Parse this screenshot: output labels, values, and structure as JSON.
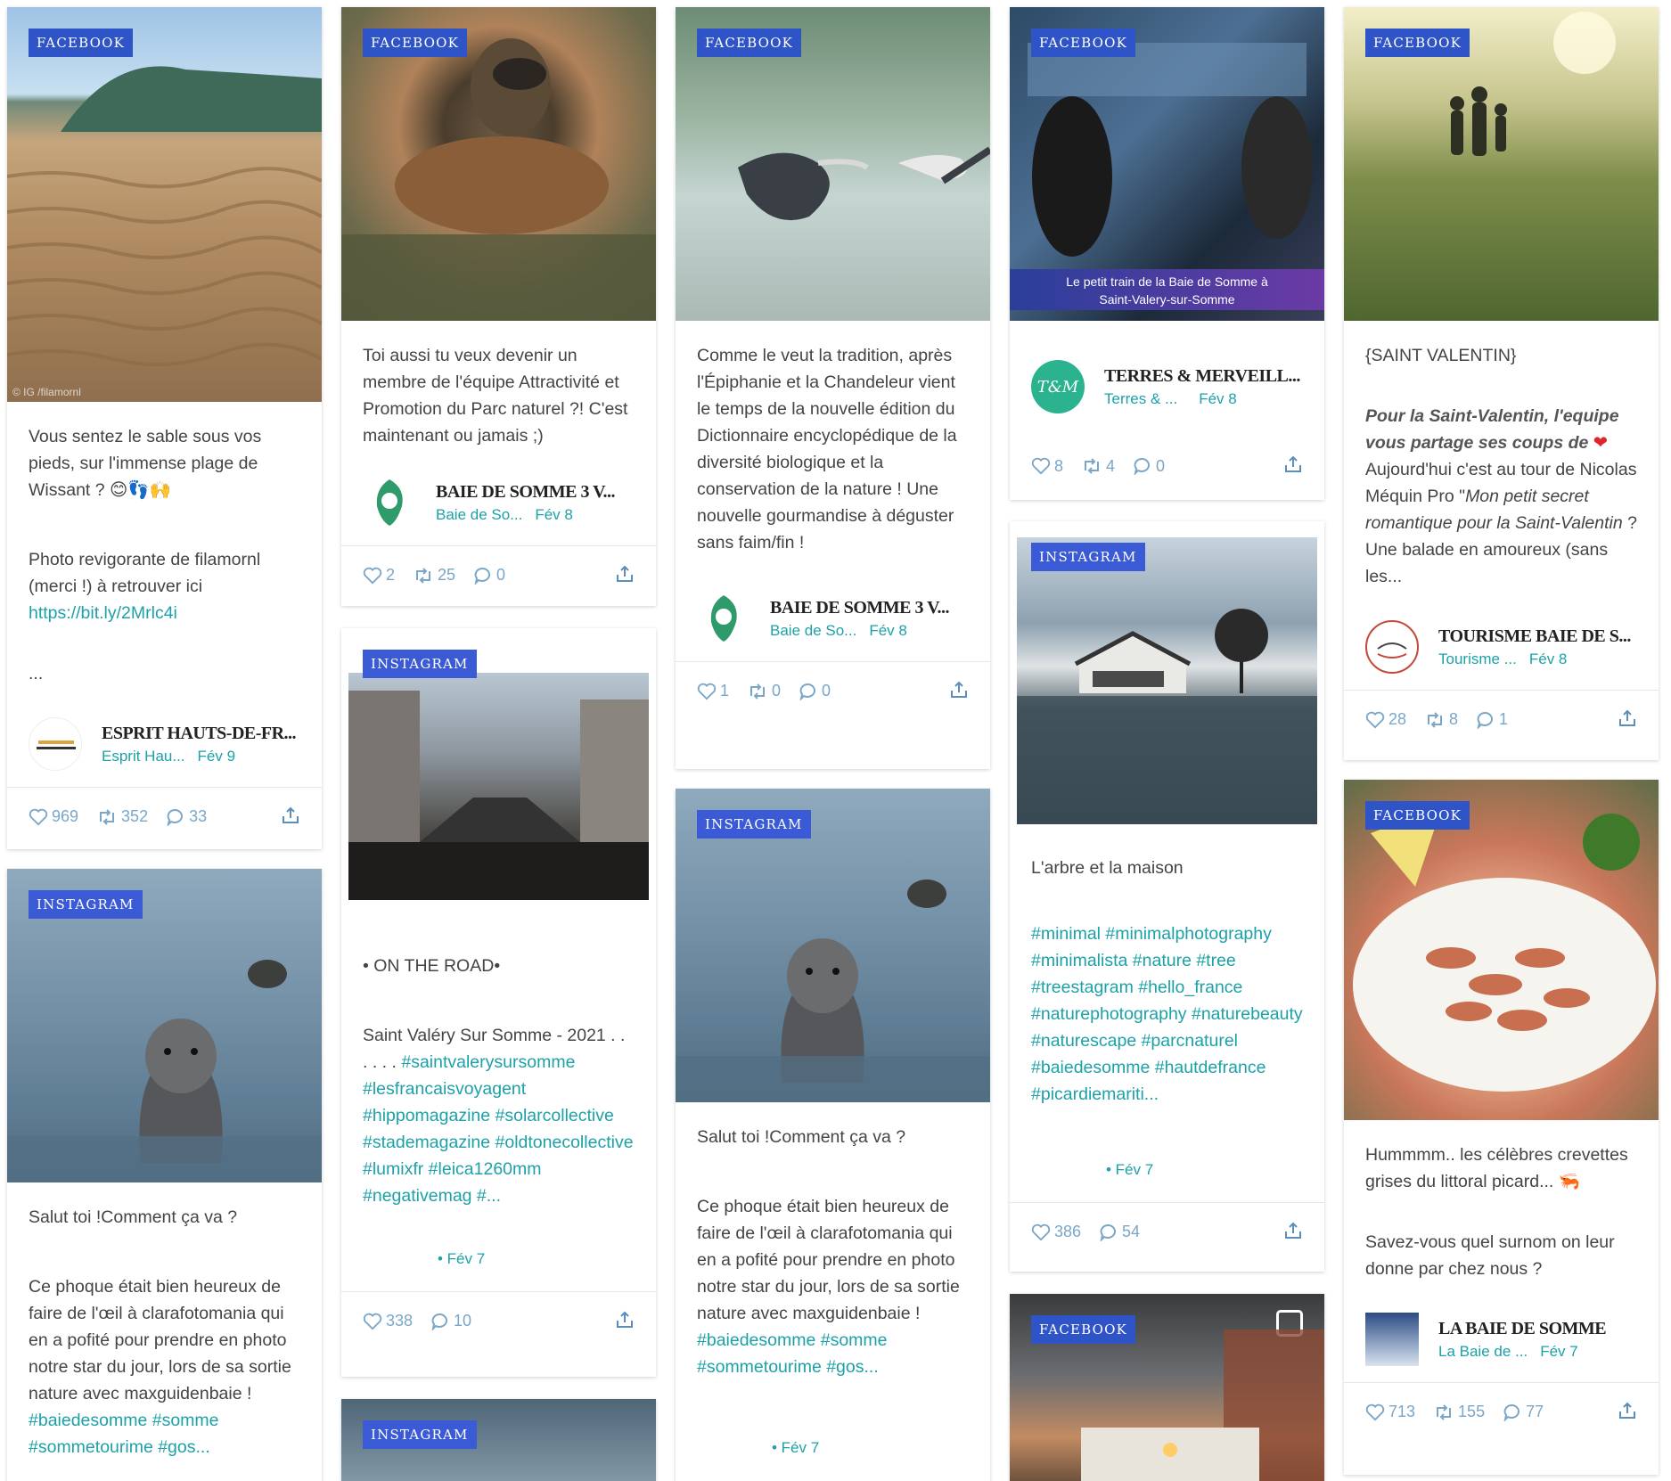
{
  "colors": {
    "badge": "#2f54c8",
    "accent": "#1da1a8",
    "icon": "#7aa6c8"
  },
  "cards": {
    "c1": {
      "badge": "FACEBOOK",
      "credit": "© IG /filamornl",
      "p1": "Vous sentez le sable sous vos pieds, sur l'immense plage de Wissant ? 😊👣🙌",
      "p2": "Photo revigorante de filamornl (merci !) à retrouver ici",
      "link": "https://bit.ly/2Mrlc4i",
      "p3": "...",
      "author": "ESPRIT HAUTS-DE-FR...",
      "handle": "Esprit Hau...",
      "date": "Fév 9",
      "likes": "969",
      "retweets": "352",
      "comments": "33"
    },
    "c2": {
      "badge": "INSTAGRAM",
      "p1": "Salut toi !Comment ça va ?",
      "p2a": "Ce phoque était bien heureux de faire de l'œil à clarafotomania qui en a pofité pour prendre en photo notre star du jour, lors de sa sortie nature avec maxguidenbaie ! ",
      "tags": "#baiedesomme #somme #sommetourime #gos..."
    },
    "c3": {
      "badge": "FACEBOOK",
      "p1": "Toi aussi tu veux devenir un membre de l'équipe Attractivité et Promotion du Parc naturel ?! C'est maintenant ou jamais ;)",
      "author": "BAIE DE SOMME 3 V...",
      "handle": "Baie de So...",
      "date": "Fév 8",
      "likes": "2",
      "retweets": "25",
      "comments": "0"
    },
    "c4": {
      "badge": "INSTAGRAM",
      "p1": "• ON THE ROAD•",
      "p2a": "Saint Valéry Sur Somme - 2021 . . . . . . ",
      "tags": "#saintvalerysursomme #lesfrancaisvoyagent #hippomagazine #solarcollective #stademagazine #oldtonecollective #lumixfr #leica1260mm #negativemag #...",
      "date": "• Fév 7",
      "likes": "338",
      "comments": "10"
    },
    "c5": {
      "badge": "INSTAGRAM"
    },
    "c6": {
      "badge": "FACEBOOK",
      "p1": "Comme le veut la tradition, après l'Épiphanie et la Chandeleur vient le temps de la nouvelle édition du Dictionnaire encyclopédique de la diversité biologique et la conservation de la nature ! Une nouvelle gourmandise à déguster sans faim/fin !",
      "author": "BAIE DE SOMME 3 V...",
      "handle": "Baie de So...",
      "date": "Fév 8",
      "likes": "1",
      "retweets": "0",
      "comments": "0"
    },
    "c7": {
      "badge": "INSTAGRAM",
      "p1": "Salut toi !Comment ça va ?",
      "p2a": "Ce phoque était bien heureux de faire de l'œil à clarafotomania qui en a pofité pour prendre en photo notre star du jour, lors de sa sortie nature avec maxguidenbaie ! ",
      "tags": "#baiedesomme #somme #sommetourime #gos...",
      "date": "• Fév 7"
    },
    "c8": {
      "badge": "FACEBOOK",
      "caption1": "Le petit train de la Baie de Somme à",
      "caption2": "Saint-Valery-sur-Somme",
      "author": "TERRES & MERVEILL...",
      "handle": "Terres & ...",
      "date": "Fév 8",
      "avatar_text": "T&M",
      "likes": "8",
      "retweets": "4",
      "comments": "0"
    },
    "c9": {
      "badge": "INSTAGRAM",
      "p1": "L'arbre et la maison",
      "tags": "#minimal #minimalphotography #minimalista #nature #tree #treestagram #hello_france #naturephotography #naturebeauty #naturescape #parcnaturel #baiedesomme #hautdefrance #picardiemariti...",
      "date": "• Fév 7",
      "likes": "386",
      "comments": "54"
    },
    "c10": {
      "badge": "FACEBOOK"
    },
    "c11": {
      "badge": "FACEBOOK",
      "p1": "{SAINT VALENTIN}",
      "p2i": "Pour la Saint-Valentin, l'equipe vous partage ses coups de",
      "p2b": " Aujourd'hui c'est au tour de Nicolas Méquin Pro \"",
      "p2i2": "Mon petit secret romantique pour la Saint-Valentin",
      "p2c": " ? Une balade en amoureux (sans les...",
      "author": "TOURISME BAIE DE S...",
      "handle": "Tourisme ...",
      "date": "Fév 8",
      "likes": "28",
      "retweets": "8",
      "comments": "1"
    },
    "c12": {
      "badge": "FACEBOOK",
      "p1": "Hummmm.. les célèbres crevettes grises du littoral picard... 🦐",
      "p2": "Savez-vous quel surnom on leur donne par chez nous ?",
      "author": "LA BAIE DE SOMME",
      "handle": "La Baie de ...",
      "date": "Fév 7",
      "likes": "713",
      "retweets": "155",
      "comments": "77"
    }
  }
}
